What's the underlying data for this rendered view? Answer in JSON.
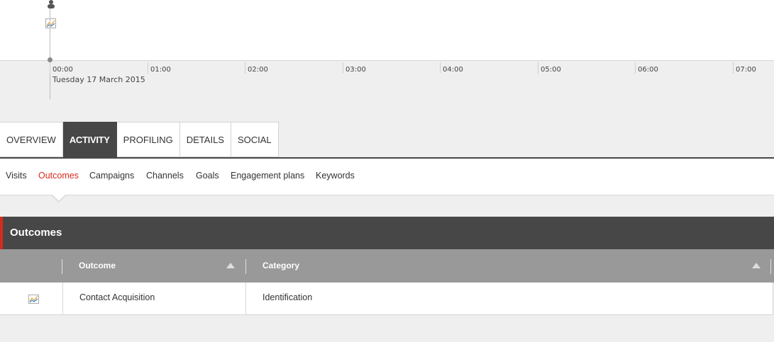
{
  "timeline": {
    "ticks": [
      "00:00",
      "01:00",
      "02:00",
      "03:00",
      "04:00",
      "05:00",
      "06:00",
      "07:00"
    ],
    "date": "Tuesday 17 March 2015"
  },
  "tabs": [
    {
      "label": "OVERVIEW",
      "active": false
    },
    {
      "label": "ACTIVITY",
      "active": true
    },
    {
      "label": "PROFILING",
      "active": false
    },
    {
      "label": "DETAILS",
      "active": false
    },
    {
      "label": "SOCIAL",
      "active": false
    }
  ],
  "subnav": [
    {
      "label": "Visits",
      "active": false
    },
    {
      "label": "Outcomes",
      "active": true
    },
    {
      "label": "Campaigns",
      "active": false
    },
    {
      "label": "Channels",
      "active": false
    },
    {
      "label": "Goals",
      "active": false
    },
    {
      "label": "Engagement plans",
      "active": false
    },
    {
      "label": "Keywords",
      "active": false
    }
  ],
  "panel": {
    "title": "Outcomes",
    "columns": [
      "Outcome",
      "Category"
    ],
    "rows": [
      {
        "icon": "chart-icon",
        "outcome": "Contact Acquisition",
        "category": "Identification"
      }
    ]
  },
  "colors": {
    "accent": "#d52b1e",
    "dark": "#474747",
    "header_gray": "#999999"
  }
}
